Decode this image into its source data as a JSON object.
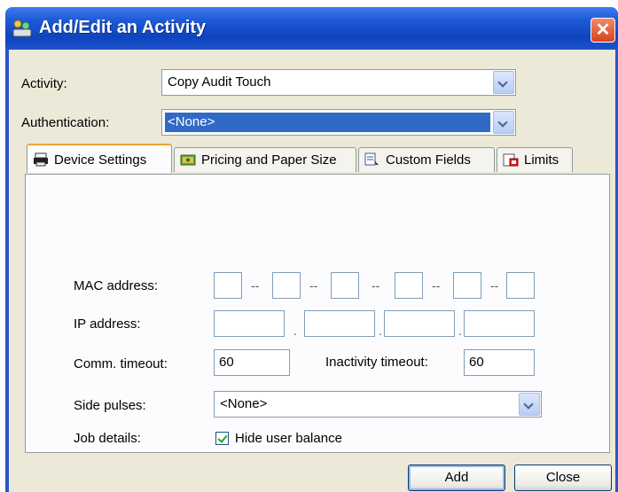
{
  "window": {
    "title": "Add/Edit an Activity",
    "close_label": "✕"
  },
  "form": {
    "activity_label": "Activity:",
    "activity_value": "Copy Audit Touch",
    "auth_label": "Authentication:",
    "auth_value": "<None>"
  },
  "tabs": [
    {
      "label": "Device Settings",
      "icon": "printer-icon"
    },
    {
      "label": "Pricing and Paper Size",
      "icon": "money-icon"
    },
    {
      "label": "Custom Fields",
      "icon": "custom-fields-icon"
    },
    {
      "label": "Limits",
      "icon": "limits-icon"
    }
  ],
  "device": {
    "mac_label": "MAC address:",
    "mac_values": [
      "",
      "",
      "",
      "",
      "",
      ""
    ],
    "mac_separator": "--",
    "ip_label": "IP address:",
    "ip_values": [
      "",
      "",
      "",
      ""
    ],
    "ip_separator": ".",
    "comm_timeout_label": "Comm. timeout:",
    "comm_timeout_value": "60",
    "inactivity_label": "Inactivity timeout:",
    "inactivity_value": "60",
    "side_pulses_label": "Side pulses:",
    "side_pulses_value": "<None>",
    "job_details_label": "Job details:",
    "hide_balance_label": "Hide user balance",
    "hide_balance_checked": true
  },
  "buttons": {
    "add": "Add",
    "close": "Close"
  }
}
